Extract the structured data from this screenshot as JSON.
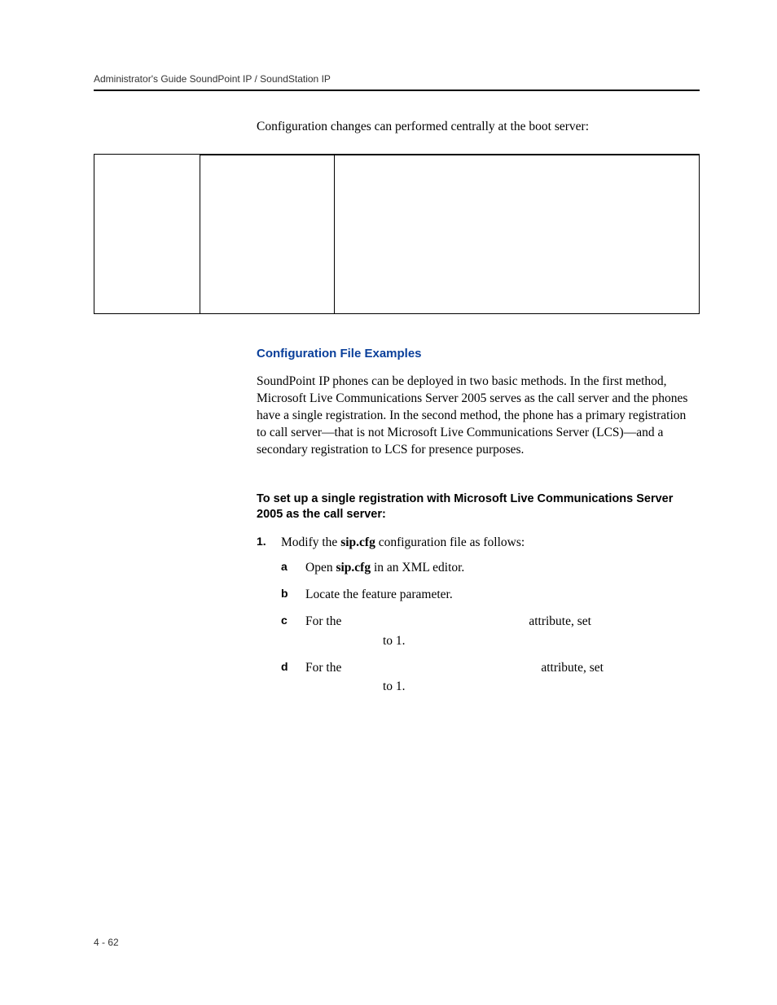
{
  "header": {
    "running_title": "Administrator's Guide SoundPoint IP / SoundStation IP"
  },
  "intro": "Configuration changes can performed centrally at the boot server:",
  "section": {
    "examples_heading": "Configuration File Examples",
    "examples_body": "SoundPoint IP phones can be deployed in two basic methods. In the first method, Microsoft Live Communications Server 2005 serves as the call server and the phones have a single registration. In the second method, the phone has a primary registration to call server—that is not Microsoft Live Communications Server (LCS)—and a secondary registration to LCS for presence purposes."
  },
  "procedure": {
    "title": "To set up a single registration with Microsoft Live Communications Server 2005 as the call server:",
    "step1": {
      "num": "1.",
      "text_before": "Modify the ",
      "bold": "sip.cfg",
      "text_after": " configuration file as follows:",
      "sub": {
        "a": {
          "letter": "a",
          "before": "Open ",
          "bold": "sip.cfg",
          "after": " in an XML editor."
        },
        "b": {
          "letter": "b",
          "text": "Locate the feature parameter."
        },
        "c": {
          "letter": "c",
          "line1_before": "For the",
          "line1_after": "attribute, set",
          "line2": "to 1."
        },
        "d": {
          "letter": "d",
          "line1_before": "For the",
          "line1_after": "attribute, set",
          "line2": "to 1."
        }
      }
    }
  },
  "page_number": "4 - 62"
}
